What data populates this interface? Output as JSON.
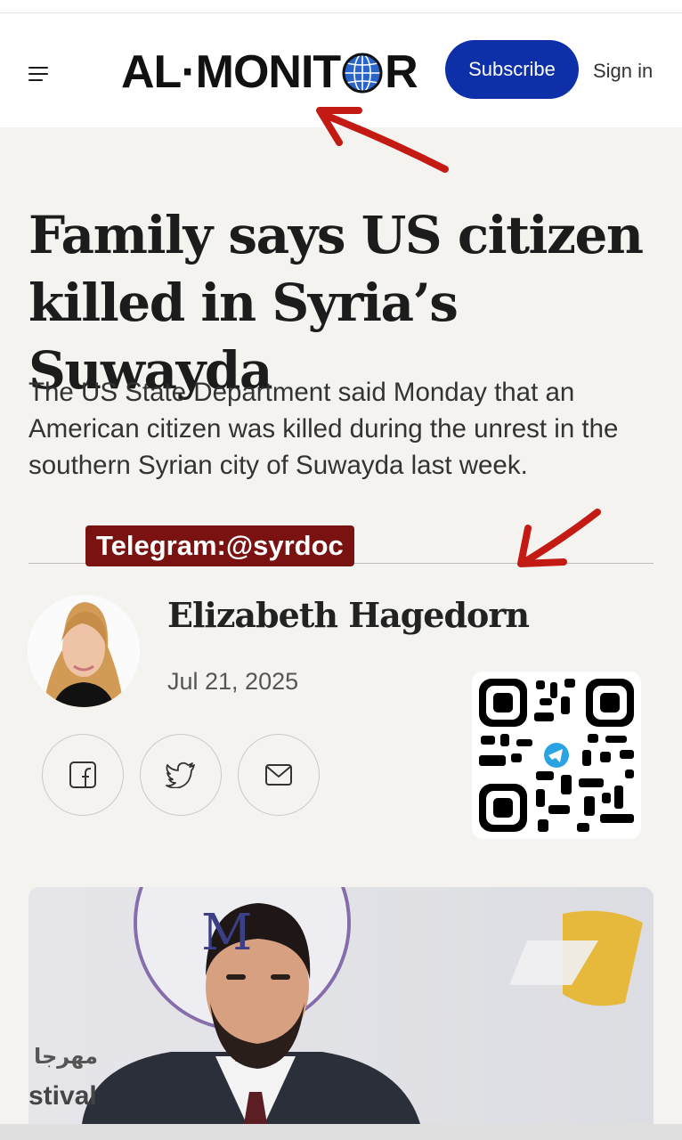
{
  "header": {
    "logo_text_left": "AL·MONIT",
    "logo_text_right": "R",
    "subscribe_label": "Subscribe",
    "signin_label": "Sign in"
  },
  "article": {
    "headline": "Family says US citizen killed in Syria’s Suwayda",
    "dek": "The US State Department said Monday that an American citizen was killed during the unrest in the southern Syrian city of Suwayda last week.",
    "author": "Elizabeth Hagedorn",
    "date": "Jul 21, 2025"
  },
  "overlay": {
    "telegram_label": "Telegram:@syrdoc"
  },
  "photo": {
    "banner_text_1": "مهرجا",
    "banner_text_2": "stival",
    "banner_letter": "M"
  },
  "icons": {
    "menu": "hamburger-icon",
    "globe": "globe-icon",
    "facebook": "facebook-icon",
    "twitter": "twitter-icon",
    "email": "email-icon",
    "qr": "telegram-qr-code"
  },
  "colors": {
    "accent": "#0d2fa8",
    "telegram_bg": "#7a1212",
    "arrow": "#c41a14",
    "page_bg": "#f4f3f0"
  }
}
